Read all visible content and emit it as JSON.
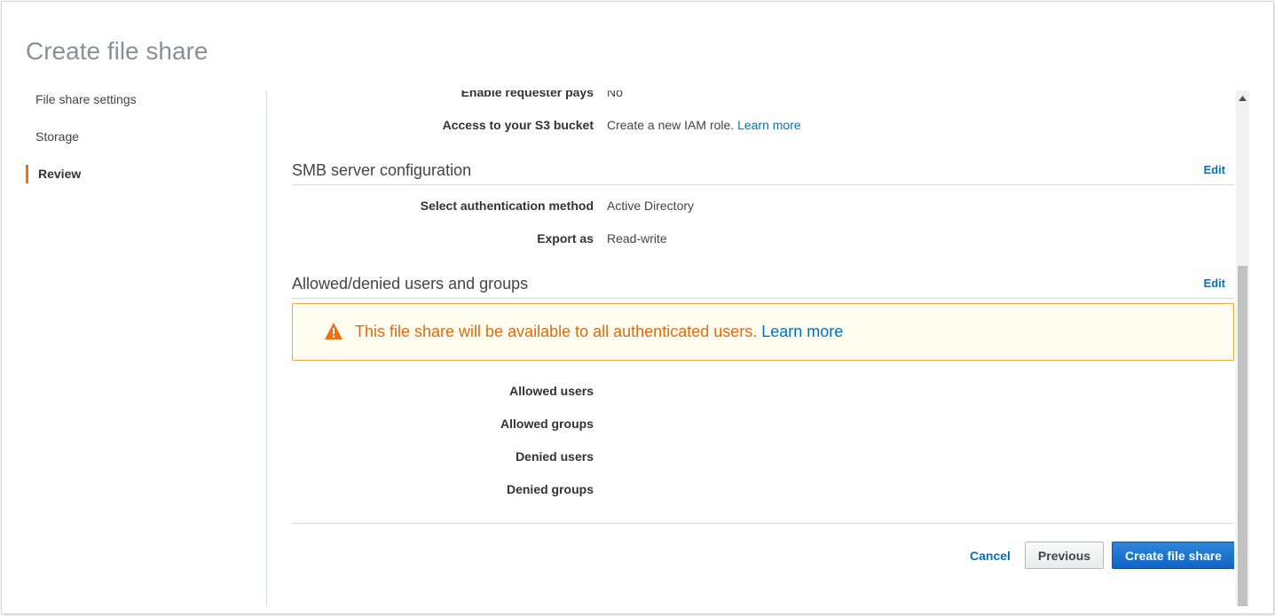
{
  "page": {
    "title": "Create file share"
  },
  "sidebar": {
    "items": [
      {
        "label": "File share settings"
      },
      {
        "label": "Storage"
      },
      {
        "label": "Review"
      }
    ]
  },
  "storage_section": {
    "requester_pays_label": "Enable requester pays",
    "requester_pays_value": "No",
    "s3_access_label": "Access to your S3 bucket",
    "s3_access_value": "Create a new IAM role.",
    "s3_access_link": "Learn more"
  },
  "smb_section": {
    "title": "SMB server configuration",
    "edit_label": "Edit",
    "auth_method_label": "Select authentication method",
    "auth_method_value": "Active Directory",
    "export_as_label": "Export as",
    "export_as_value": "Read-write"
  },
  "access_section": {
    "title": "Allowed/denied users and groups",
    "edit_label": "Edit",
    "alert_text": "This file share will be available to all authenticated users.",
    "alert_link": "Learn more",
    "allowed_users_label": "Allowed users",
    "allowed_groups_label": "Allowed groups",
    "denied_users_label": "Denied users",
    "denied_groups_label": "Denied groups"
  },
  "footer": {
    "cancel_label": "Cancel",
    "previous_label": "Previous",
    "create_label": "Create file share"
  },
  "icons": {
    "warning": "warning-icon",
    "scroll_up": "scroll-up-arrow-icon"
  },
  "colors": {
    "accent": "#ec7211",
    "link": "#0073bb",
    "primary_button": "#0d64c7",
    "warning": "#dd6b10"
  }
}
